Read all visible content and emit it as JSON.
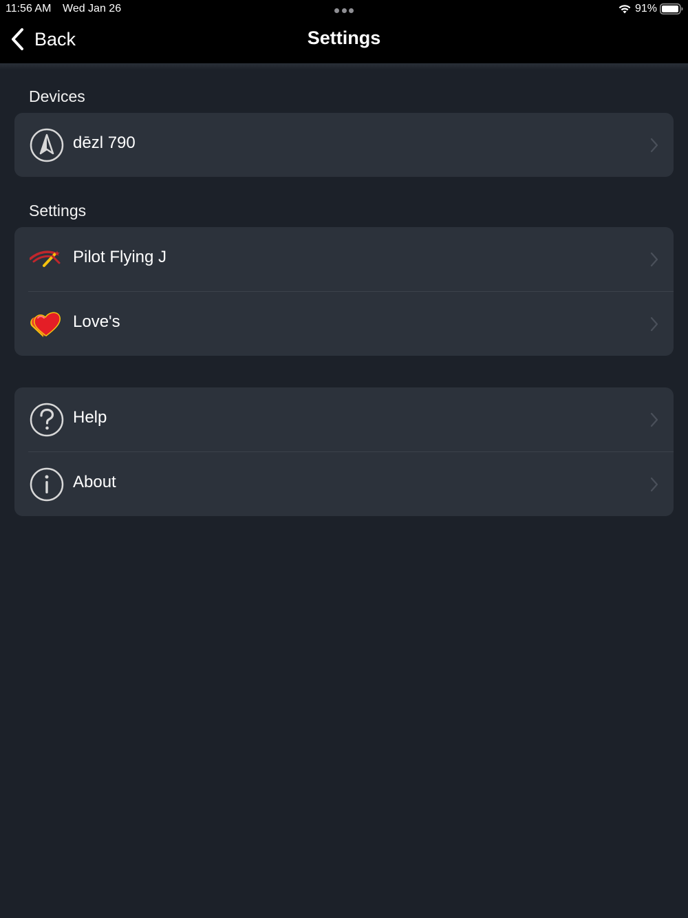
{
  "status_bar": {
    "time": "11:56 AM",
    "date": "Wed Jan 26",
    "battery": "91%"
  },
  "nav": {
    "back_label": "Back",
    "title": "Settings"
  },
  "sections": {
    "devices": {
      "header": "Devices",
      "items": [
        {
          "label": "dēzl 790",
          "icon": "navigation-arrow-icon"
        }
      ]
    },
    "settings": {
      "header": "Settings",
      "items": [
        {
          "label": "Pilot Flying J",
          "icon": "pilot-flying-j-logo"
        },
        {
          "label": "Love's",
          "icon": "loves-heart-logo"
        }
      ]
    },
    "other": {
      "items": [
        {
          "label": "Help",
          "icon": "question-icon"
        },
        {
          "label": "About",
          "icon": "info-icon"
        }
      ]
    }
  },
  "colors": {
    "background": "#1c2129",
    "cell": "#2c323b",
    "topbar": "#000000",
    "chevron": "#4a505a"
  }
}
